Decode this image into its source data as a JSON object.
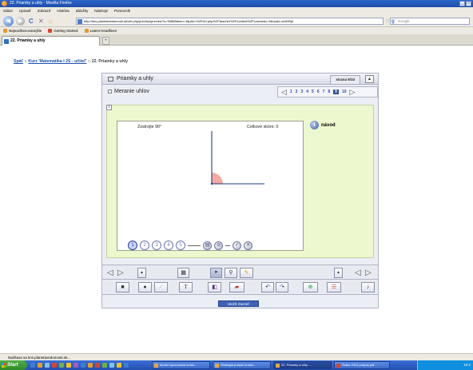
{
  "window": {
    "title": "22. Priamky a uhly - Mozilla Firefox",
    "controls": [
      "_",
      "□"
    ]
  },
  "menu": [
    "Súbor",
    "Upraviť",
    "Zobraziť",
    "História",
    "Záložky",
    "Nástroje",
    "Pomocník"
  ],
  "navigation": {
    "url": "http://lms.planetavedomosti.sk/ctrl.php/preview/preview?u=94888atom=16pbk=%2Fctrl.php%2Fteacher%2Fcontent%2Fcourse&c=5&node=a1690pl",
    "search_placeholder": "Google"
  },
  "bookmarks": [
    "Najnavštevovanejšie",
    "Getting Started",
    "Latest Headlines"
  ],
  "tab": {
    "title": "22. Priamky a uhly",
    "new_tab": "+"
  },
  "breadcrumb": {
    "back": "Späť",
    "sep1": " :: ",
    "course": "Kurz 'Matematika I 2S - učiteľ'",
    "sep2": " :: ",
    "current": "22. Priamky a uhly"
  },
  "lesson": {
    "title": "Priamky a uhly",
    "page_indicator": "strana 9/10",
    "subtitle": "Meranie uhlov",
    "pages": [
      "1",
      "2",
      "3",
      "4",
      "5",
      "6",
      "7",
      "8",
      "9",
      "10"
    ],
    "current_page": "9",
    "task": "Zostrojte 90°",
    "score": "Celkové skóre: 0",
    "help": "návod",
    "info_label": "i",
    "steps": [
      "1",
      "2",
      "3",
      "4",
      "5"
    ],
    "active_step": "1"
  },
  "toolbar": {
    "text_tool": "T"
  },
  "save_button": "Uložiť Zavrieť",
  "status": "Načítava sa lms.planetavedomosti.sk...",
  "taskbar": {
    "start": "Start",
    "tasks": [
      "Model vyuzovania hodín...",
      "Stratégia pobytu krumo...",
      "22. Priamky a uhly -...",
      "Sutaz 2010 pokyny.pdf..."
    ],
    "time": "10:2"
  },
  "colors": {
    "angle_fill": "#f7a8a0",
    "axis": "#1f3c8a",
    "workspace": "#eef8cf",
    "page_active": "#2e4f9b"
  }
}
